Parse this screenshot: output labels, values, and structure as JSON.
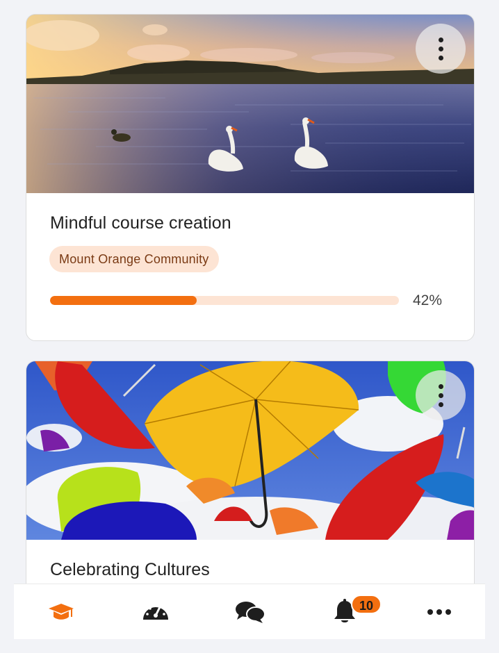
{
  "courses": [
    {
      "title": "Mindful course creation",
      "category": "Mount Orange Community",
      "progress_label": "42%",
      "progress": 0.42,
      "image": "lake-with-swans",
      "menu_icon": "kebab-menu-icon"
    },
    {
      "title": "Celebrating Cultures",
      "image": "colorful-umbrellas",
      "menu_icon": "kebab-menu-icon"
    }
  ],
  "tabbar": {
    "tabs": [
      {
        "name": "my-courses",
        "icon": "graduation-cap-icon",
        "active": true
      },
      {
        "name": "dashboard",
        "icon": "speedometer-icon",
        "active": false
      },
      {
        "name": "messages",
        "icon": "chat-bubbles-icon",
        "active": false
      },
      {
        "name": "notifications",
        "icon": "bell-icon",
        "active": false,
        "badge": "10"
      },
      {
        "name": "more",
        "icon": "more-dots-icon",
        "active": false
      }
    ]
  },
  "colors": {
    "accent": "#f36f10",
    "badge_bg": "#fde4d4",
    "badge_text": "#7a3a14",
    "icon_dark": "#1e1e1e"
  }
}
